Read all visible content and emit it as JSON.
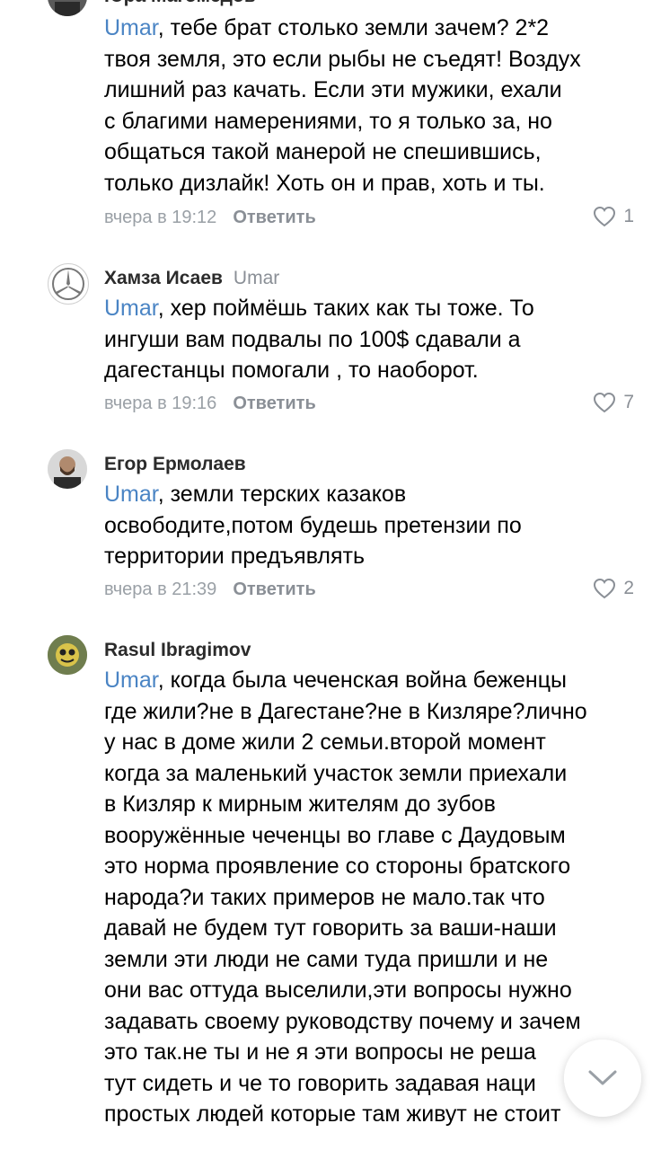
{
  "comments": [
    {
      "author": "Юра Магомедов",
      "reply_to": "",
      "mention": "Umar",
      "text": ", тебе брат столько земли зачем? 2*2\nтвоя земля, это если рыбы не съедят! Воздух\nлишний раз качать. Если эти мужики, ехали\nс благими намерениями, то я только за, но\nобщаться такой манерой не спешившись,\nтолько дизлайк! Хоть он и прав, хоть и ты.",
      "time": "вчера в 19:12",
      "reply_label": "Ответить",
      "likes": "1"
    },
    {
      "author": "Хамза Исаев",
      "reply_to": "Umar",
      "mention": "Umar",
      "text": ", хер поймёшь таких как ты тоже. То\nингуши вам подвалы по 100$ сдавали а\nдагестанцы помогали , то наоборот.",
      "time": "вчера в 19:16",
      "reply_label": "Ответить",
      "likes": "7"
    },
    {
      "author": "Егор Ермолаев",
      "reply_to": "",
      "mention": "Umar",
      "text": ", земли терских казаков\nосвободите,потом будешь претензии по\nтерритории предъявлять",
      "time": "вчера в 21:39",
      "reply_label": "Ответить",
      "likes": "2"
    },
    {
      "author": "Rasul Ibragimov",
      "reply_to": "",
      "mention": "Umar",
      "text": ", когда была чеченская война беженцы\nгде жили?не в Дагестане?не в Кизляре?лично\nу нас в доме жили 2 семьи.второй момент\nкогда за маленький участок земли приехали\nв Кизляр к мирным жителям до зубов\nвооружённые чеченцы во главе с Даудовым\nэто норма проявление со стороны братского\nнарода?и таких примеров не мало.так что\nдавай не будем тут говорить за ваши-наши\nземли эти люди не сами туда пришли и не\nони вас оттуда выселили,эти вопросы нужно\nзадавать своему руководству почему и зачем\nэто так.не ты и не я эти вопросы не реша\nтут сидеть и че то говорить задавая наци\nпростых людей которые там живут не стоит"
    }
  ],
  "icons": {
    "like": "heart-outline-icon",
    "scroll": "chevron-down-icon"
  },
  "colors": {
    "mention": "#4a84c4",
    "meta": "#9aa0a6"
  }
}
